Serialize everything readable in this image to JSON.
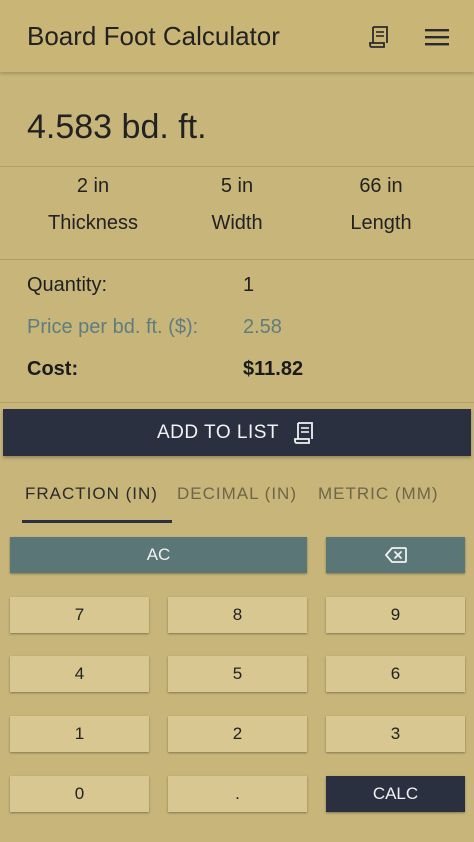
{
  "appbar": {
    "title": "Board Foot Calculator",
    "list_icon": "receipt-list-icon",
    "menu_icon": "hamburger-menu-icon"
  },
  "result": {
    "text": "4.583 bd. ft."
  },
  "dimensions": {
    "thickness": {
      "value": "2 in",
      "label": "Thickness"
    },
    "width": {
      "value": "5 in",
      "label": "Width"
    },
    "length": {
      "value": "66 in",
      "label": "Length"
    }
  },
  "details": {
    "quantity_label": "Quantity:",
    "quantity_value": "1",
    "price_label": "Price per bd. ft. ($):",
    "price_value": "2.58",
    "cost_label": "Cost:",
    "cost_value": "$11.82"
  },
  "add_to_list": {
    "label": "ADD TO LIST"
  },
  "tabs": [
    {
      "label": "FRACTION (IN)",
      "active": true
    },
    {
      "label": "DECIMAL (IN)",
      "active": false
    },
    {
      "label": "METRIC (MM)",
      "active": false
    }
  ],
  "keypad": {
    "ac": "AC",
    "backspace_icon": "backspace-icon",
    "k7": "7",
    "k8": "8",
    "k9": "9",
    "k4": "4",
    "k5": "5",
    "k6": "6",
    "k1": "1",
    "k2": "2",
    "k3": "3",
    "k0": "0",
    "dot": ".",
    "calc": "CALC"
  },
  "colors": {
    "background": "#c7b57a",
    "dark": "#2b3040",
    "teal": "#5b7677",
    "key": "#d8c791",
    "muted_text": "#5f7d7e"
  }
}
